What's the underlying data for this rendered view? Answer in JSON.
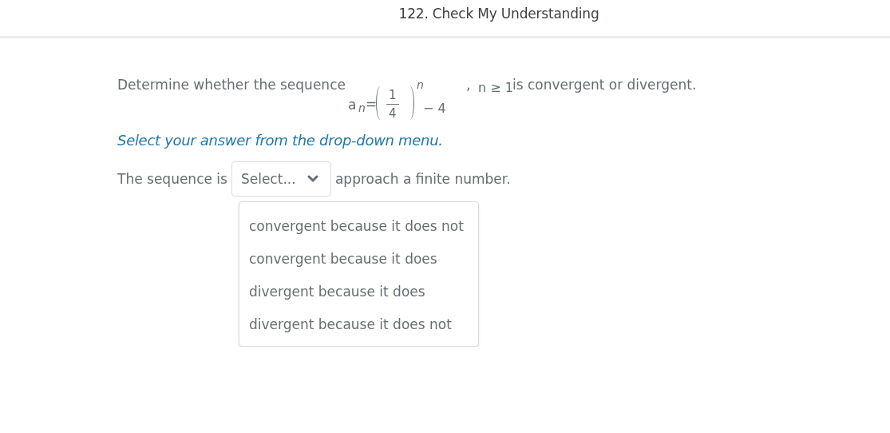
{
  "header": {
    "title": "122. Check My Understanding"
  },
  "question": {
    "intro": "Determine whether the sequence",
    "formula": {
      "base": "a",
      "index": "n",
      "equals": "=",
      "numerator": "1",
      "denominator": "4",
      "exponent": "n",
      "tail": "− 4",
      "comma": ",",
      "condition": "n ≥ 1"
    },
    "outro": "is convergent or divergent."
  },
  "instruction": "Select your answer from the drop-down menu.",
  "answer": {
    "before": "The sequence is",
    "after": "approach a finite number.",
    "select": {
      "placeholder": "Select...",
      "expanded": true,
      "options": [
        {
          "label": "convergent because it does not",
          "selected": false
        },
        {
          "label": "convergent because it does",
          "selected": false
        },
        {
          "label": "divergent because it does",
          "selected": false
        },
        {
          "label": "divergent because it does not",
          "selected": false
        }
      ]
    }
  }
}
